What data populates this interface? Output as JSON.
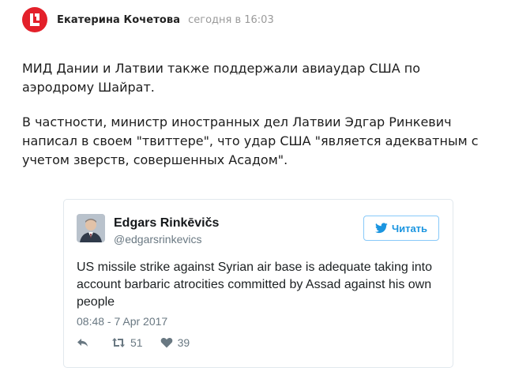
{
  "post": {
    "logo_letter": "L",
    "author": "Екатерина Кочетова",
    "timestamp": "сегодня в 16:03",
    "paragraph1": "МИД Дании и Латвии также поддержали авиаудар США по аэродрому Шайрат.",
    "paragraph2": "В частности, министр иностранных дел Латвии Эдгар Ринкевич написал в своем \"твиттере\", что удар США \"является адекватным с учетом зверств, совершенных Асадом\"."
  },
  "tweet": {
    "name": "Edgars Rinkēvičs",
    "handle": "@edgarsrinkevics",
    "follow_label": "Читать",
    "text": "US missile strike against Syrian air base is adequate taking into account barbaric atrocities committed by Assad against his own people",
    "time": "08:48 - 7 Apr 2017",
    "retweets": "51",
    "likes": "39"
  },
  "icons": {
    "logo": "lenta-logo",
    "follow": "twitter-bird-icon",
    "reply": "reply-icon",
    "retweet": "retweet-icon",
    "like": "heart-icon"
  },
  "colors": {
    "brand": "#e3202a",
    "twitter_blue": "#1b95e0",
    "muted": "#697882"
  }
}
